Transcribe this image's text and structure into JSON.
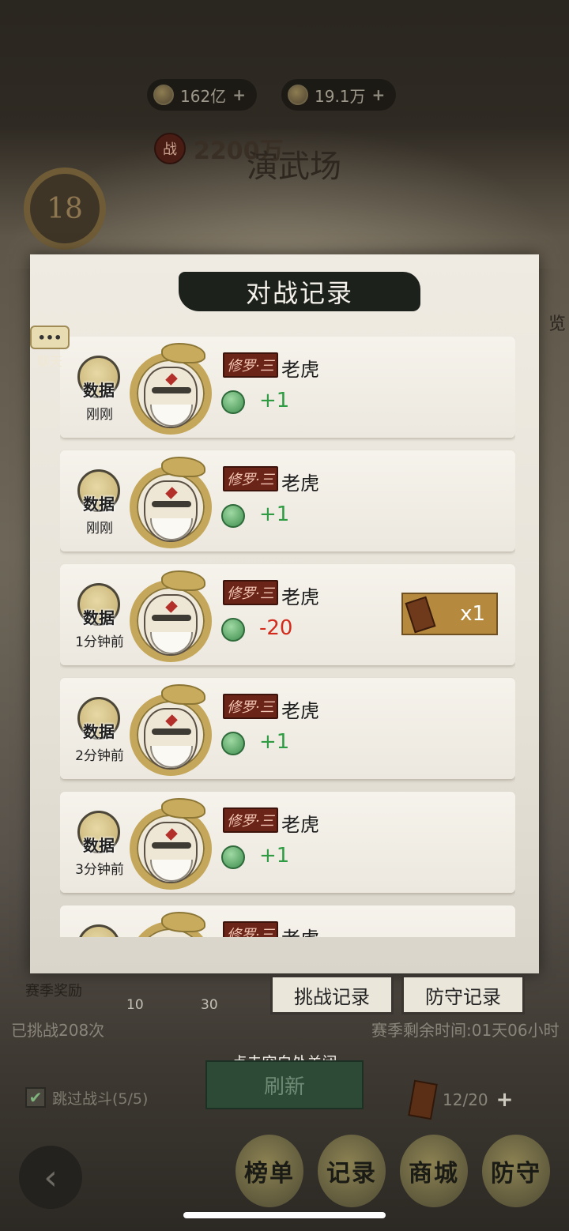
{
  "topbar": {
    "currency1": "162亿",
    "currency2": "19.1万",
    "plus": "+"
  },
  "arena": {
    "power_badge": "战",
    "power_value": "2200万",
    "title": "演武场",
    "level": "18"
  },
  "chat": {
    "dots": "•••",
    "label": "聊天"
  },
  "side_text": "览",
  "modal": {
    "title": "对战记录",
    "data_button": "数据",
    "rank_tag": "修罗·三",
    "records": [
      {
        "time": "刚刚",
        "name": "老虎",
        "score": "+1",
        "score_type": "pos",
        "reward": ""
      },
      {
        "time": "刚刚",
        "name": "老虎",
        "score": "+1",
        "score_type": "pos",
        "reward": ""
      },
      {
        "time": "1分钟前",
        "name": "老虎",
        "score": "-20",
        "score_type": "neg",
        "reward": "x1"
      },
      {
        "time": "2分钟前",
        "name": "老虎",
        "score": "+1",
        "score_type": "pos",
        "reward": ""
      },
      {
        "time": "3分钟前",
        "name": "老虎",
        "score": "+1",
        "score_type": "pos",
        "reward": ""
      },
      {
        "time": "",
        "name": "老虎",
        "score": "",
        "score_type": "pos",
        "reward": ""
      }
    ]
  },
  "tabs": {
    "challenge": "挑战记录",
    "defense": "防守记录"
  },
  "season": {
    "label": "赛季奖励",
    "tier1": "10",
    "tier2": "30",
    "challenged": "已挑战208次",
    "remaining": "赛季剩余时间:01天06小时"
  },
  "close_hint": "点击空白处关闭",
  "refresh": "刷新",
  "skip_battle": "跳过战斗(5/5)",
  "checkbox_mark": "✔",
  "tickets": "12/20",
  "back_icon": "‹",
  "nav": {
    "rank": "榜单",
    "record": "记录",
    "shop": "商城",
    "defend": "防守"
  }
}
